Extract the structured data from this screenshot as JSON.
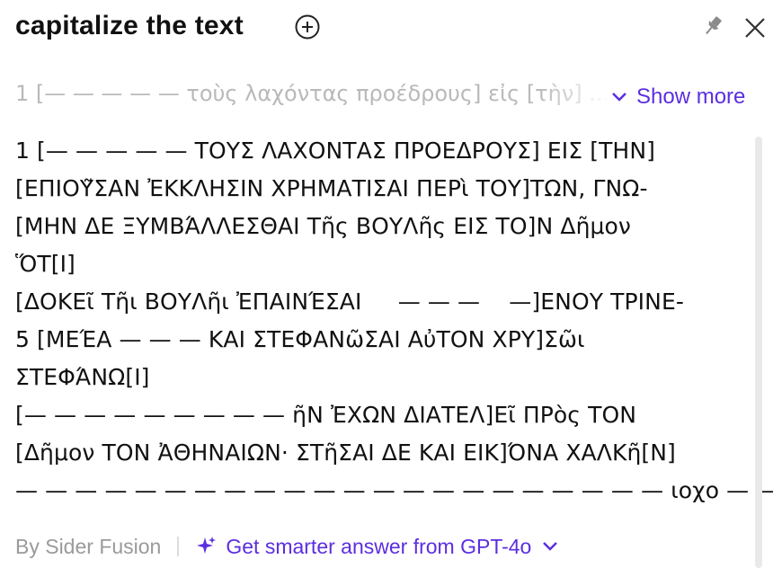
{
  "header": {
    "title": "capitalize the text"
  },
  "prompt": {
    "text": "1 [— — — — — τοὺς λαχόντας προέδρους] εἰς [τὴν] ...",
    "show_more_label": "Show more"
  },
  "answer": {
    "lines": [
      "1 [— — — — — ΤΟΥΣ ΛΑΧΟΝΤΑΣ ΠΡΟΕΔΡΟΥΣ] ΕΙΣ [ΤΗΝ]",
      "[ΕΠΙΟΥ͂ΣΑΝ ἘΚΚΛΗΣΙΝ ΧΡΗΜΑΤΙΣΑΙ ΠΕΡὶ ΤΟΥ]ΤΩΝ, ΓΝΩ-",
      "[ΜΗΝ ΔΕ ΞΥΜΒΆΛΛΕΣΘΑΙ Τῆς ΒΟΥΛῆς ΕΙΣ ΤΟ]Ν Δῆμον",
      "ὍΤ[Ι]",
      "[ΔΟΚΕῖ Τῆι ΒΟΥΛῆι ἘΠΑΙΝΈΣΑΙ     — — —    —]ΕΝΟΥ ΤΡΙΝΕ-",
      "5 [ΜΕΈΑ — — — ΚΑΙ ΣΤΕΦΑΝῶΣΑΙ ΑὐΤΟΝ ΧΡΥ]Σῶι",
      "ΣΤΕΦΆΝΩ[Ι]",
      "[— — — — — — — — — ῆΝ ἘΧΩΝ ΔΙΑΤΕΛ]Εῖ ΠΡὸς ΤΟΝ",
      "[Δῆμον ΤΟΝ ἈΘΗΝΑΙΩΝ· ΣΤῆΣΑΙ ΔΕ ΚΑΙ ΕΙΚ]ΌΝΑ ΧΑΛΚῆ[Ν]",
      "— — — — — — — — — — — — — — — — — — — — — — ιοχο — —"
    ]
  },
  "footer": {
    "by_label": "By Sider Fusion",
    "smart_label": "Get smarter answer from GPT-4o"
  },
  "colors": {
    "accent": "#5b2ee0",
    "prompt_text": "#b9b9b9",
    "muted": "#9a9a9a"
  },
  "icons": [
    "plus-circle-icon",
    "pin-icon",
    "close-icon",
    "chevron-down-icon",
    "sparkle-icon"
  ]
}
